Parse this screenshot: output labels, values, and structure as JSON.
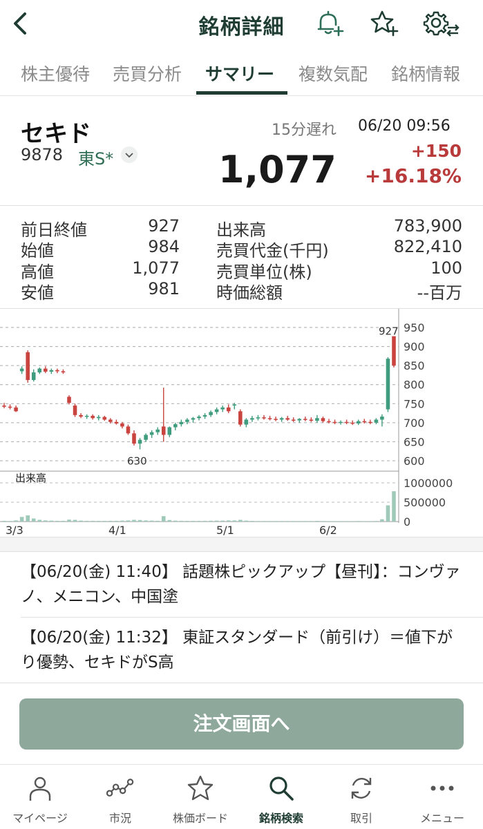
{
  "header": {
    "title": "銘柄詳細"
  },
  "tabs": [
    {
      "label": "株主優待"
    },
    {
      "label": "売買分析"
    },
    {
      "label": "サマリー"
    },
    {
      "label": "複数気配"
    },
    {
      "label": "銘柄情報"
    }
  ],
  "stock": {
    "name": "セキド",
    "code": "9878",
    "market": "東S*",
    "delay": "15分遅れ",
    "time": "06/20 09:56",
    "price": "1,077",
    "change": "+150",
    "change_pct": "+16.18%"
  },
  "stats": {
    "left": [
      {
        "label": "前日終値",
        "value": "927"
      },
      {
        "label": "始値",
        "value": "984"
      },
      {
        "label": "高値",
        "value": "1,077"
      },
      {
        "label": "安値",
        "value": "981"
      }
    ],
    "right": [
      {
        "label": "出来高",
        "value": "783,900"
      },
      {
        "label": "売買代金(千円)",
        "value": "822,410"
      },
      {
        "label": "売買単位(株)",
        "value": "100"
      },
      {
        "label": "時価総額",
        "value": "--百万"
      }
    ]
  },
  "chart_data": {
    "type": "candlestick",
    "price_axis": {
      "ylim": [
        600,
        950
      ],
      "ticks": [
        "950",
        "900",
        "850",
        "800",
        "750",
        "700",
        "650",
        "600"
      ]
    },
    "volume_axis": {
      "label": "出来高",
      "ylim": [
        0,
        1000000
      ],
      "ticks": [
        "1000000",
        "500000",
        "0"
      ]
    },
    "x_ticks": [
      "3/3",
      "4/1",
      "5/1",
      "6/2"
    ],
    "annotations": [
      {
        "text": "927",
        "value": 927
      },
      {
        "text": "630",
        "value": 630
      }
    ],
    "grid": true,
    "up_color": "#3f9c7e",
    "down_color": "#c9433f",
    "candles": [
      {
        "o": 745,
        "h": 752,
        "l": 738,
        "c": 742,
        "v": 20000
      },
      {
        "o": 742,
        "h": 748,
        "l": 735,
        "c": 740,
        "v": 15000
      },
      {
        "o": 740,
        "h": 745,
        "l": 728,
        "c": 730,
        "v": 30000
      },
      {
        "o": 835,
        "h": 848,
        "l": 828,
        "c": 842,
        "v": 120000
      },
      {
        "o": 885,
        "h": 890,
        "l": 805,
        "c": 812,
        "v": 160000
      },
      {
        "o": 812,
        "h": 840,
        "l": 808,
        "c": 832,
        "v": 80000
      },
      {
        "o": 832,
        "h": 845,
        "l": 828,
        "c": 842,
        "v": 45000
      },
      {
        "o": 842,
        "h": 848,
        "l": 830,
        "c": 834,
        "v": 30000
      },
      {
        "o": 834,
        "h": 842,
        "l": 828,
        "c": 838,
        "v": 25000
      },
      {
        "o": 838,
        "h": 842,
        "l": 830,
        "c": 835,
        "v": 20000
      },
      {
        "o": 835,
        "h": 840,
        "l": 828,
        "c": 832,
        "v": 20000
      },
      {
        "o": 768,
        "h": 772,
        "l": 748,
        "c": 752,
        "v": 50000
      },
      {
        "o": 745,
        "h": 750,
        "l": 715,
        "c": 720,
        "v": 45000
      },
      {
        "o": 720,
        "h": 725,
        "l": 712,
        "c": 716,
        "v": 25000
      },
      {
        "o": 716,
        "h": 722,
        "l": 710,
        "c": 718,
        "v": 20000
      },
      {
        "o": 718,
        "h": 722,
        "l": 708,
        "c": 712,
        "v": 20000
      },
      {
        "o": 712,
        "h": 720,
        "l": 706,
        "c": 715,
        "v": 18000
      },
      {
        "o": 715,
        "h": 718,
        "l": 705,
        "c": 708,
        "v": 18000
      },
      {
        "o": 708,
        "h": 712,
        "l": 698,
        "c": 702,
        "v": 20000
      },
      {
        "o": 702,
        "h": 708,
        "l": 695,
        "c": 698,
        "v": 20000
      },
      {
        "o": 698,
        "h": 702,
        "l": 685,
        "c": 690,
        "v": 25000
      },
      {
        "o": 690,
        "h": 695,
        "l": 668,
        "c": 672,
        "v": 30000
      },
      {
        "o": 672,
        "h": 680,
        "l": 640,
        "c": 645,
        "v": 45000
      },
      {
        "o": 645,
        "h": 660,
        "l": 630,
        "c": 655,
        "v": 40000
      },
      {
        "o": 655,
        "h": 672,
        "l": 650,
        "c": 668,
        "v": 30000
      },
      {
        "o": 668,
        "h": 680,
        "l": 660,
        "c": 675,
        "v": 25000
      },
      {
        "o": 675,
        "h": 688,
        "l": 668,
        "c": 682,
        "v": 20000
      },
      {
        "o": 690,
        "h": 792,
        "l": 650,
        "c": 668,
        "v": 140000
      },
      {
        "o": 668,
        "h": 690,
        "l": 662,
        "c": 688,
        "v": 40000
      },
      {
        "o": 688,
        "h": 700,
        "l": 680,
        "c": 696,
        "v": 25000
      },
      {
        "o": 696,
        "h": 708,
        "l": 690,
        "c": 702,
        "v": 20000
      },
      {
        "o": 702,
        "h": 712,
        "l": 696,
        "c": 708,
        "v": 18000
      },
      {
        "o": 708,
        "h": 715,
        "l": 700,
        "c": 712,
        "v": 18000
      },
      {
        "o": 712,
        "h": 720,
        "l": 706,
        "c": 716,
        "v": 18000
      },
      {
        "o": 716,
        "h": 725,
        "l": 710,
        "c": 720,
        "v": 20000
      },
      {
        "o": 720,
        "h": 732,
        "l": 715,
        "c": 728,
        "v": 22000
      },
      {
        "o": 728,
        "h": 740,
        "l": 722,
        "c": 735,
        "v": 25000
      },
      {
        "o": 735,
        "h": 745,
        "l": 728,
        "c": 740,
        "v": 25000
      },
      {
        "o": 740,
        "h": 748,
        "l": 725,
        "c": 730,
        "v": 30000
      },
      {
        "o": 745,
        "h": 752,
        "l": 735,
        "c": 748,
        "v": 30000
      },
      {
        "o": 730,
        "h": 735,
        "l": 690,
        "c": 695,
        "v": 45000
      },
      {
        "o": 695,
        "h": 712,
        "l": 688,
        "c": 708,
        "v": 25000
      },
      {
        "o": 708,
        "h": 718,
        "l": 702,
        "c": 712,
        "v": 18000
      },
      {
        "o": 712,
        "h": 720,
        "l": 706,
        "c": 714,
        "v": 15000
      },
      {
        "o": 714,
        "h": 720,
        "l": 708,
        "c": 712,
        "v": 15000
      },
      {
        "o": 712,
        "h": 718,
        "l": 706,
        "c": 710,
        "v": 15000
      },
      {
        "o": 710,
        "h": 716,
        "l": 704,
        "c": 708,
        "v": 15000
      },
      {
        "o": 708,
        "h": 715,
        "l": 702,
        "c": 712,
        "v": 15000
      },
      {
        "o": 712,
        "h": 718,
        "l": 705,
        "c": 708,
        "v": 15000
      },
      {
        "o": 708,
        "h": 714,
        "l": 702,
        "c": 706,
        "v": 15000
      },
      {
        "o": 706,
        "h": 712,
        "l": 700,
        "c": 710,
        "v": 15000
      },
      {
        "o": 710,
        "h": 716,
        "l": 704,
        "c": 708,
        "v": 15000
      },
      {
        "o": 708,
        "h": 714,
        "l": 702,
        "c": 705,
        "v": 15000
      },
      {
        "o": 705,
        "h": 720,
        "l": 700,
        "c": 712,
        "v": 18000
      },
      {
        "o": 712,
        "h": 716,
        "l": 700,
        "c": 704,
        "v": 15000
      },
      {
        "o": 704,
        "h": 710,
        "l": 698,
        "c": 702,
        "v": 12000
      },
      {
        "o": 702,
        "h": 708,
        "l": 696,
        "c": 700,
        "v": 12000
      },
      {
        "o": 700,
        "h": 706,
        "l": 695,
        "c": 702,
        "v": 12000
      },
      {
        "o": 702,
        "h": 708,
        "l": 696,
        "c": 700,
        "v": 12000
      },
      {
        "o": 700,
        "h": 706,
        "l": 694,
        "c": 698,
        "v": 12000
      },
      {
        "o": 698,
        "h": 708,
        "l": 694,
        "c": 704,
        "v": 15000
      },
      {
        "o": 704,
        "h": 710,
        "l": 698,
        "c": 702,
        "v": 12000
      },
      {
        "o": 702,
        "h": 708,
        "l": 696,
        "c": 700,
        "v": 12000
      },
      {
        "o": 700,
        "h": 712,
        "l": 696,
        "c": 708,
        "v": 15000
      },
      {
        "o": 708,
        "h": 722,
        "l": 690,
        "c": 716,
        "v": 60000
      },
      {
        "o": 735,
        "h": 872,
        "l": 728,
        "c": 868,
        "v": 420000
      },
      {
        "o": 927,
        "h": 927,
        "l": 845,
        "c": 850,
        "v": 784000
      }
    ]
  },
  "news": [
    {
      "text": "【06/20(金) 11:40】 話題株ピックアップ【昼刊】：コンヴァノ、メニコン、中国塗"
    },
    {
      "text": "【06/20(金) 11:32】 東証スタンダード（前引け）＝値下がり優勢、セキドがS高"
    }
  ],
  "order_button": {
    "label": "注文画面へ"
  },
  "bottom_nav": [
    {
      "label": "マイページ",
      "icon": "person-icon"
    },
    {
      "label": "市況",
      "icon": "line-chart-icon"
    },
    {
      "label": "株価ボード",
      "icon": "star-icon"
    },
    {
      "label": "銘柄検索",
      "icon": "search-icon"
    },
    {
      "label": "取引",
      "icon": "refresh-icon"
    },
    {
      "label": "メニュー",
      "icon": "more-icon"
    }
  ],
  "colors": {
    "brand": "#1f3d33",
    "up": "#b83a3a",
    "button": "#8fa89c"
  }
}
